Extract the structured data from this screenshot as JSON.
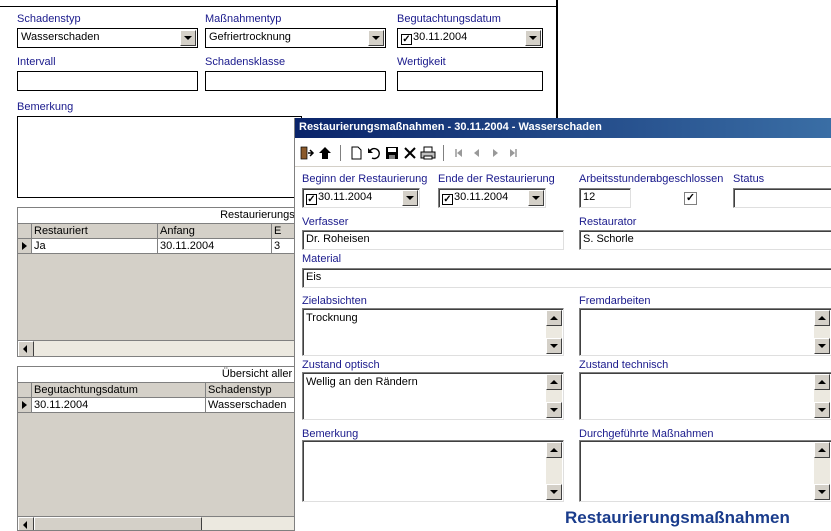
{
  "main": {
    "schadenstyp": {
      "label": "Schadenstyp",
      "value": "Wasserschaden"
    },
    "massnahmentyp": {
      "label": "Maßnahmentyp",
      "value": "Gefriertrocknung"
    },
    "begutachtungsdatum": {
      "label": "Begutachtungsdatum",
      "value": "30.11.2004"
    },
    "intervall": {
      "label": "Intervall",
      "value": ""
    },
    "schadensklasse": {
      "label": "Schadensklasse",
      "value": ""
    },
    "wertigkeit": {
      "label": "Wertigkeit",
      "value": ""
    },
    "bemerkung": {
      "label": "Bemerkung",
      "value": ""
    }
  },
  "grid1": {
    "caption": "Restaurierungsm",
    "columns": [
      "Restauriert",
      "Anfang",
      "E"
    ],
    "rows": [
      [
        "Ja",
        "30.11.2004",
        "3"
      ]
    ]
  },
  "grid2": {
    "caption": "Übersicht aller Schäden der",
    "columns": [
      "Begutachtungsdatum",
      "Schadenstyp"
    ],
    "rows": [
      [
        "30.11.2004",
        "Wasserschaden"
      ]
    ]
  },
  "dialog": {
    "title": "Restaurierungsmaßnahmen - 30.11.2004 - Wasserschaden",
    "beginn": {
      "label": "Beginn der Restaurierung",
      "value": "30.11.2004"
    },
    "ende": {
      "label": "Ende der Restaurierung",
      "value": "30.11.2004"
    },
    "arbeitsstunden": {
      "label": "Arbeitsstunden",
      "value": "12"
    },
    "abgeschlossen": {
      "label": "abgeschlossen",
      "checked": true
    },
    "status": {
      "label": "Status",
      "value": ""
    },
    "verfasser": {
      "label": "Verfasser",
      "value": "Dr. Roheisen"
    },
    "restaurator": {
      "label": "Restaurator",
      "value": "S. Schorle"
    },
    "material": {
      "label": "Material",
      "value": "Eis"
    },
    "zielabsichten": {
      "label": "Zielabsichten",
      "value": "Trocknung"
    },
    "fremdarbeiten": {
      "label": "Fremdarbeiten",
      "value": ""
    },
    "zustand_optisch": {
      "label": "Zustand optisch",
      "value": "Wellig an den Rändern"
    },
    "zustand_technisch": {
      "label": "Zustand technisch",
      "value": ""
    },
    "bemerkung": {
      "label": "Bemerkung",
      "value": ""
    },
    "durchgefuehrte": {
      "label": "Durchgeführte Maßnahmen",
      "value": ""
    },
    "footer_title": "Restaurierungsmaßnahmen",
    "toolbar_icons": [
      "exit-icon",
      "home-icon",
      "new-record-icon",
      "undo-icon",
      "save-icon",
      "delete-icon",
      "print-icon",
      "first-record-icon",
      "previous-record-icon",
      "next-record-icon",
      "last-record-icon"
    ]
  },
  "colors": {
    "label_blue": "#1a1a8c",
    "title_bar": "#0a246a",
    "heading_blue": "#1a3c8c"
  }
}
